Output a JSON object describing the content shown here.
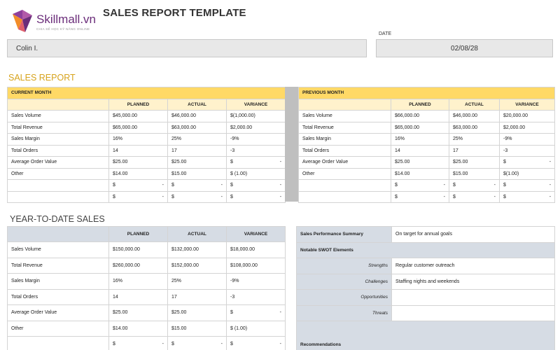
{
  "brand": {
    "name": "Skillmall.vn",
    "tagline": "CHIA SẺ HỌC KỸ NĂNG ONLINE",
    "colors": {
      "purple": "#6b2d7a",
      "orange": "#f28c28"
    }
  },
  "title": "SALES REPORT TEMPLATE",
  "header": {
    "name": "Colin I.",
    "date_label": "DATE",
    "date": "02/08/28"
  },
  "sales_report": {
    "title": "SALES REPORT",
    "current": {
      "heading": "CURRENT MONTH",
      "columns": [
        "PLANNED",
        "ACTUAL",
        "VARIANCE"
      ],
      "rows": [
        {
          "label": "Sales Volume",
          "planned": "$45,000.00",
          "actual": "$46,000.00",
          "variance": "$(1,000.00)"
        },
        {
          "label": "Total Revenue",
          "planned": "$65,000.00",
          "actual": "$63,000.00",
          "variance": "$2,000.00"
        },
        {
          "label": "Sales Margin",
          "planned": "16%",
          "actual": "25%",
          "variance": "-9%"
        },
        {
          "label": "Total Orders",
          "planned": "14",
          "actual": "17",
          "variance": "-3"
        },
        {
          "label": "Average Order Value",
          "planned": "$25.00",
          "actual": "$25.00",
          "variance_sym": "$",
          "variance_val": "-"
        },
        {
          "label": "Other",
          "planned": "$14.00",
          "actual": "$15.00",
          "variance": "$ (1.00)"
        }
      ],
      "empty_symbol": "$",
      "empty_value": "-"
    },
    "previous": {
      "heading": "PREVIOUS MONTH",
      "columns": [
        "PLANNED",
        "ACTUAL",
        "VARIANCE"
      ],
      "rows": [
        {
          "label": "Sales Volume",
          "planned": "$66,000.00",
          "actual": "$46,000.00",
          "variance": "$20,000.00"
        },
        {
          "label": "Total Revenue",
          "planned": "$65,000.00",
          "actual": "$63,000.00",
          "variance": "$2,000.00"
        },
        {
          "label": "Sales Margin",
          "planned": "16%",
          "actual": "25%",
          "variance": "-9%"
        },
        {
          "label": "Total Orders",
          "planned": "14",
          "actual": "17",
          "variance": "-3"
        },
        {
          "label": "Average Order Value",
          "planned": "$25.00",
          "actual": "$25.00",
          "variance_sym": "$",
          "variance_val": "-"
        },
        {
          "label": "Other",
          "planned": "$14.00",
          "actual": "$15.00",
          "variance": "$(1.00)"
        }
      ]
    }
  },
  "ytd": {
    "title": "YEAR-TO-DATE SALES",
    "columns": [
      "PLANNED",
      "ACTUAL",
      "VARIANCE"
    ],
    "rows": [
      {
        "label": "Sales Volume",
        "planned": "$150,000.00",
        "actual": "$132,000.00",
        "variance": "$18,000.00"
      },
      {
        "label": "Total Revenue",
        "planned": "$260,000.00",
        "actual": "$152,000.00",
        "variance": "$108,000.00"
      },
      {
        "label": "Sales Margin",
        "planned": "16%",
        "actual": "25%",
        "variance": "-9%"
      },
      {
        "label": "Total Orders",
        "planned": "14",
        "actual": "17",
        "variance": "-3"
      },
      {
        "label": "Average Order Value",
        "planned": "$25.00",
        "actual": "$25.00",
        "variance_sym": "$",
        "variance_val": "-"
      },
      {
        "label": "Other",
        "planned": "$14.00",
        "actual": "$15.00",
        "variance": "$ (1.00)"
      }
    ]
  },
  "summary": {
    "performance_label": "Sales Performance Summary",
    "performance_value": "On target for annual goals",
    "swot_heading": "Notable SWOT Elements",
    "swot": [
      {
        "label": "Strengths",
        "value": "Regular customer outreach"
      },
      {
        "label": "Challenges",
        "value": "Staffing nights and weekends"
      },
      {
        "label": "Opportunities",
        "value": ""
      },
      {
        "label": "Threats",
        "value": ""
      }
    ],
    "recommendations_label": "Recommendations"
  }
}
